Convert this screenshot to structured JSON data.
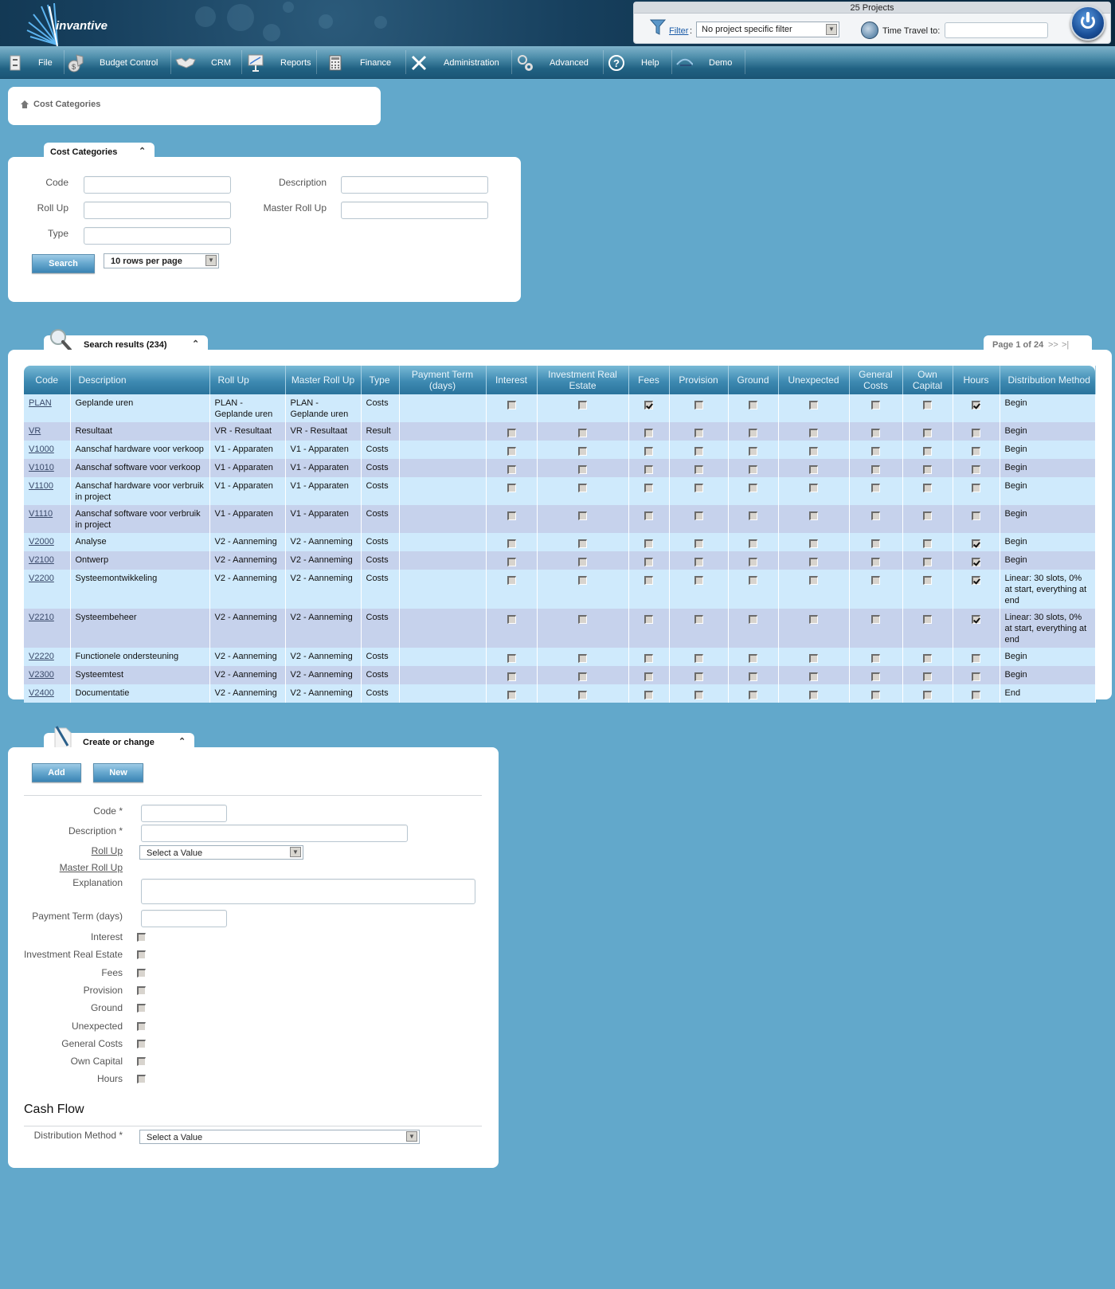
{
  "header": {
    "logo_text": "invantive",
    "projects_title": "25 Projects",
    "filter_label": "Filter",
    "filter_colon": ":",
    "filter_value": "No project specific filter",
    "time_travel_label": "Time Travel to:",
    "time_travel_value": ""
  },
  "nav": {
    "items": [
      {
        "label": "File",
        "icon": "file-cabinet-icon"
      },
      {
        "label": "Budget Control",
        "icon": "money-bag-icon"
      },
      {
        "label": "CRM",
        "icon": "handshake-icon"
      },
      {
        "label": "Reports",
        "icon": "presentation-icon"
      },
      {
        "label": "Finance",
        "icon": "calculator-icon"
      },
      {
        "label": "Administration",
        "icon": "tools-icon"
      },
      {
        "label": "Advanced",
        "icon": "gears-icon"
      },
      {
        "label": "Help",
        "icon": "help-icon"
      },
      {
        "label": "Demo",
        "icon": "demo-icon"
      }
    ]
  },
  "breadcrumb": {
    "label": "Cost Categories"
  },
  "search_panel": {
    "tab_title": "Cost Categories",
    "fields": {
      "code_label": "Code",
      "description_label": "Description",
      "rollup_label": "Roll Up",
      "master_rollup_label": "Master Roll Up",
      "type_label": "Type"
    },
    "search_button": "Search",
    "rows_per_page": "10 rows per page"
  },
  "results": {
    "tab_title": "Search results (234)",
    "pagination": {
      "text": "Page 1 of 24",
      "next": ">>",
      "last": ">|"
    },
    "columns": [
      "Code",
      "Description",
      "Roll Up",
      "Master Roll Up",
      "Type",
      "Payment Term (days)",
      "Interest",
      "Investment Real Estate",
      "Fees",
      "Provision",
      "Ground",
      "Unexpected",
      "General Costs",
      "Own Capital",
      "Hours",
      "Distribution Method"
    ],
    "rows": [
      {
        "code": "PLAN",
        "description": "Geplande uren",
        "rollup": "PLAN - Geplande uren",
        "master": "PLAN - Geplande uren",
        "type": "Costs",
        "term": "",
        "flags": [
          0,
          0,
          1,
          0,
          0,
          0,
          0,
          0,
          1
        ],
        "dist": "Begin"
      },
      {
        "code": "VR",
        "description": "Resultaat",
        "rollup": "VR - Resultaat",
        "master": "VR - Resultaat",
        "type": "Result",
        "term": "",
        "flags": [
          0,
          0,
          0,
          0,
          0,
          0,
          0,
          0,
          0
        ],
        "dist": "Begin"
      },
      {
        "code": "V1000",
        "description": "Aanschaf hardware voor verkoop",
        "rollup": "V1 - Apparaten",
        "master": "V1 - Apparaten",
        "type": "Costs",
        "term": "",
        "flags": [
          0,
          0,
          0,
          0,
          0,
          0,
          0,
          0,
          0
        ],
        "dist": "Begin"
      },
      {
        "code": "V1010",
        "description": "Aanschaf software voor verkoop",
        "rollup": "V1 - Apparaten",
        "master": "V1 - Apparaten",
        "type": "Costs",
        "term": "",
        "flags": [
          0,
          0,
          0,
          0,
          0,
          0,
          0,
          0,
          0
        ],
        "dist": "Begin"
      },
      {
        "code": "V1100",
        "description": "Aanschaf hardware voor verbruik in project",
        "rollup": "V1 - Apparaten",
        "master": "V1 - Apparaten",
        "type": "Costs",
        "term": "",
        "flags": [
          0,
          0,
          0,
          0,
          0,
          0,
          0,
          0,
          0
        ],
        "dist": "Begin"
      },
      {
        "code": "V1110",
        "description": "Aanschaf software voor verbruik in project",
        "rollup": "V1 - Apparaten",
        "master": "V1 - Apparaten",
        "type": "Costs",
        "term": "",
        "flags": [
          0,
          0,
          0,
          0,
          0,
          0,
          0,
          0,
          0
        ],
        "dist": "Begin"
      },
      {
        "code": "V2000",
        "description": "Analyse",
        "rollup": "V2 - Aanneming",
        "master": "V2 - Aanneming",
        "type": "Costs",
        "term": "",
        "flags": [
          0,
          0,
          0,
          0,
          0,
          0,
          0,
          0,
          1
        ],
        "dist": "Begin"
      },
      {
        "code": "V2100",
        "description": "Ontwerp",
        "rollup": "V2 - Aanneming",
        "master": "V2 - Aanneming",
        "type": "Costs",
        "term": "",
        "flags": [
          0,
          0,
          0,
          0,
          0,
          0,
          0,
          0,
          1
        ],
        "dist": "Begin"
      },
      {
        "code": "V2200",
        "description": "Systeemontwikkeling",
        "rollup": "V2 - Aanneming",
        "master": "V2 - Aanneming",
        "type": "Costs",
        "term": "",
        "flags": [
          0,
          0,
          0,
          0,
          0,
          0,
          0,
          0,
          1
        ],
        "dist": "Linear: 30 slots, 0% at start, everything at end"
      },
      {
        "code": "V2210",
        "description": "Systeembeheer",
        "rollup": "V2 - Aanneming",
        "master": "V2 - Aanneming",
        "type": "Costs",
        "term": "",
        "flags": [
          0,
          0,
          0,
          0,
          0,
          0,
          0,
          0,
          1
        ],
        "dist": "Linear: 30 slots, 0% at start, everything at end"
      },
      {
        "code": "V2220",
        "description": "Functionele ondersteuning",
        "rollup": "V2 - Aanneming",
        "master": "V2 - Aanneming",
        "type": "Costs",
        "term": "",
        "flags": [
          0,
          0,
          0,
          0,
          0,
          0,
          0,
          0,
          0
        ],
        "dist": "Begin"
      },
      {
        "code": "V2300",
        "description": "Systeemtest",
        "rollup": "V2 - Aanneming",
        "master": "V2 - Aanneming",
        "type": "Costs",
        "term": "",
        "flags": [
          0,
          0,
          0,
          0,
          0,
          0,
          0,
          0,
          0
        ],
        "dist": "Begin"
      },
      {
        "code": "V2400",
        "description": "Documentatie",
        "rollup": "V2 - Aanneming",
        "master": "V2 - Aanneming",
        "type": "Costs",
        "term": "",
        "flags": [
          0,
          0,
          0,
          0,
          0,
          0,
          0,
          0,
          0
        ],
        "dist": "End"
      }
    ]
  },
  "create_panel": {
    "tab_title": "Create or change",
    "add_button": "Add",
    "new_button": "New",
    "code_label": "Code *",
    "description_label": "Description *",
    "rollup_label": "Roll Up",
    "rollup_value": "Select a Value",
    "master_rollup_label": "Master Roll Up",
    "explanation_label": "Explanation",
    "payment_term_label": "Payment Term (days)",
    "checkboxes": [
      {
        "label": "Interest",
        "checked": false
      },
      {
        "label": "Investment Real Estate",
        "checked": false
      },
      {
        "label": "Fees",
        "checked": false
      },
      {
        "label": "Provision",
        "checked": false
      },
      {
        "label": "Ground",
        "checked": false
      },
      {
        "label": "Unexpected",
        "checked": false
      },
      {
        "label": "General Costs",
        "checked": false
      },
      {
        "label": "Own Capital",
        "checked": false
      },
      {
        "label": "Hours",
        "checked": false
      }
    ],
    "cash_flow_heading": "Cash Flow",
    "distribution_label": "Distribution Method *",
    "distribution_value": "Select a Value"
  }
}
